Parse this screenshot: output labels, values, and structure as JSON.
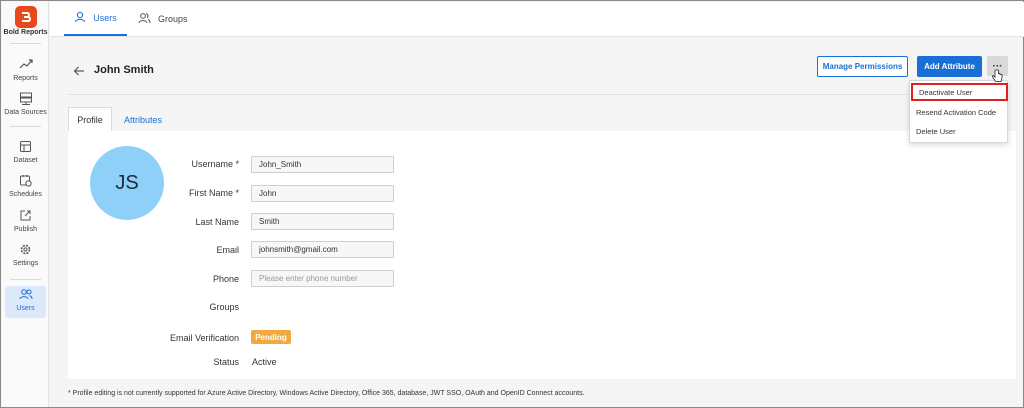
{
  "sidebar": {
    "brand": "Bold Reports",
    "items": [
      {
        "label": "Reports",
        "icon": "trending-up-icon"
      },
      {
        "label": "Data Sources",
        "icon": "server-icon"
      },
      {
        "label": "Dataset",
        "icon": "table-icon"
      },
      {
        "label": "Schedules",
        "icon": "calendar-clock-icon"
      },
      {
        "label": "Publish",
        "icon": "publish-icon"
      },
      {
        "label": "Settings",
        "icon": "gear-icon"
      },
      {
        "label": "Users",
        "icon": "users-icon",
        "active": true
      }
    ]
  },
  "top_tabs": [
    {
      "label": "Users",
      "icon": "user-icon",
      "active": true
    },
    {
      "label": "Groups",
      "icon": "group-icon",
      "active": false
    }
  ],
  "header": {
    "title": "John Smith",
    "manage_permissions": "Manage Permissions",
    "add_attribute": "Add Attribute",
    "more": "···"
  },
  "menu": {
    "items": [
      "Deactivate User",
      "Resend Activation Code",
      "Delete User"
    ],
    "highlighted": "Deactivate User"
  },
  "content_tabs": [
    "Profile",
    "Attributes"
  ],
  "profile": {
    "initials": "JS",
    "fields": [
      {
        "label": "Username *",
        "value": "John_Smith",
        "placeholder": ""
      },
      {
        "label": "First Name *",
        "value": "John",
        "placeholder": ""
      },
      {
        "label": "Last Name",
        "value": "Smith",
        "placeholder": ""
      },
      {
        "label": "Email",
        "value": "johnsmith@gmail.com",
        "placeholder": ""
      },
      {
        "label": "Phone",
        "value": "",
        "placeholder": "Please enter phone number"
      }
    ],
    "groups_label": "Groups",
    "email_verification_label": "Email Verification",
    "email_verification_value": "Pending",
    "status_label": "Status",
    "status_value": "Active"
  },
  "footnote": "* Profile editing is not currently supported for Azure Active Directory, Windows Active Directory, Office 365, database, JWT SSO, OAuth and OpenID Connect accounts.",
  "colors": {
    "accent": "#1a6fd6",
    "brand": "#e8481c",
    "pending": "#f1a941",
    "avatar": "#8fd0f8",
    "highlight": "#e02020"
  }
}
